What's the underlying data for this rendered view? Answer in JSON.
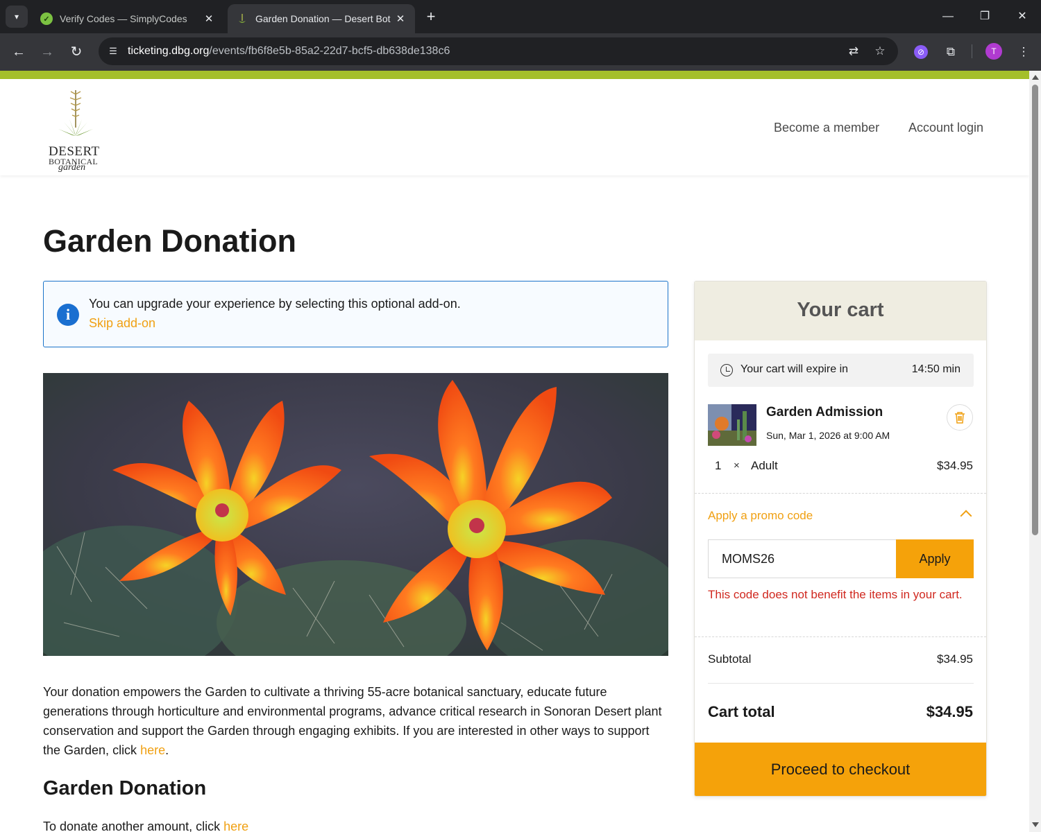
{
  "browser": {
    "tabs": [
      {
        "title": "Verify Codes — SimplyCodes",
        "active": false
      },
      {
        "title": "Garden Donation — Desert Bot",
        "active": true
      }
    ],
    "url_host": "ticketing.dbg.org",
    "url_path": "/events/fb6f8e5b-85a2-22d7-bcf5-db638de138c6",
    "profile_initial": "T"
  },
  "header": {
    "logo_line1": "DESERT",
    "logo_line2": "BOTANICAL",
    "logo_line3": "garden",
    "nav": [
      "Become a member",
      "Account login"
    ]
  },
  "main": {
    "title": "Garden Donation",
    "info_message": "You can upgrade your experience by selecting this optional add-on.",
    "skip_link": "Skip add-on",
    "description_text": "Your donation empowers the Garden to cultivate a thriving 55-acre botanical sanctuary, educate future generations through horticulture and environmental programs, advance critical research in Sonoran Desert plant conservation and support the Garden through engaging exhibits. If you are interested in other ways to support the Garden, click ",
    "description_link": "here",
    "description_end": ".",
    "section_title": "Garden Donation",
    "more_text": "To donate another amount, click ",
    "more_link": "here"
  },
  "cart": {
    "title": "Your cart",
    "expire_label": "Your cart will expire in",
    "expire_value": "14:50 min",
    "item": {
      "name": "Garden Admission",
      "date": "Sun, Mar 1, 2026 at 9:00 AM",
      "quantity": "1",
      "times": "×",
      "ticket_type": "Adult",
      "price": "$34.95"
    },
    "promo": {
      "toggle_label": "Apply a promo code",
      "value": "MOMS26",
      "apply_label": "Apply",
      "error": "This code does not benefit the items in your cart."
    },
    "subtotal_label": "Subtotal",
    "subtotal_value": "$34.95",
    "total_label": "Cart total",
    "total_value": "$34.95",
    "checkout_label": "Proceed to checkout"
  },
  "colors": {
    "accent_bar": "#a4bf2a",
    "brand_orange": "#f5a20a",
    "link_orange": "#f0a012",
    "error_red": "#d0281f",
    "info_blue": "#1a73c9"
  }
}
